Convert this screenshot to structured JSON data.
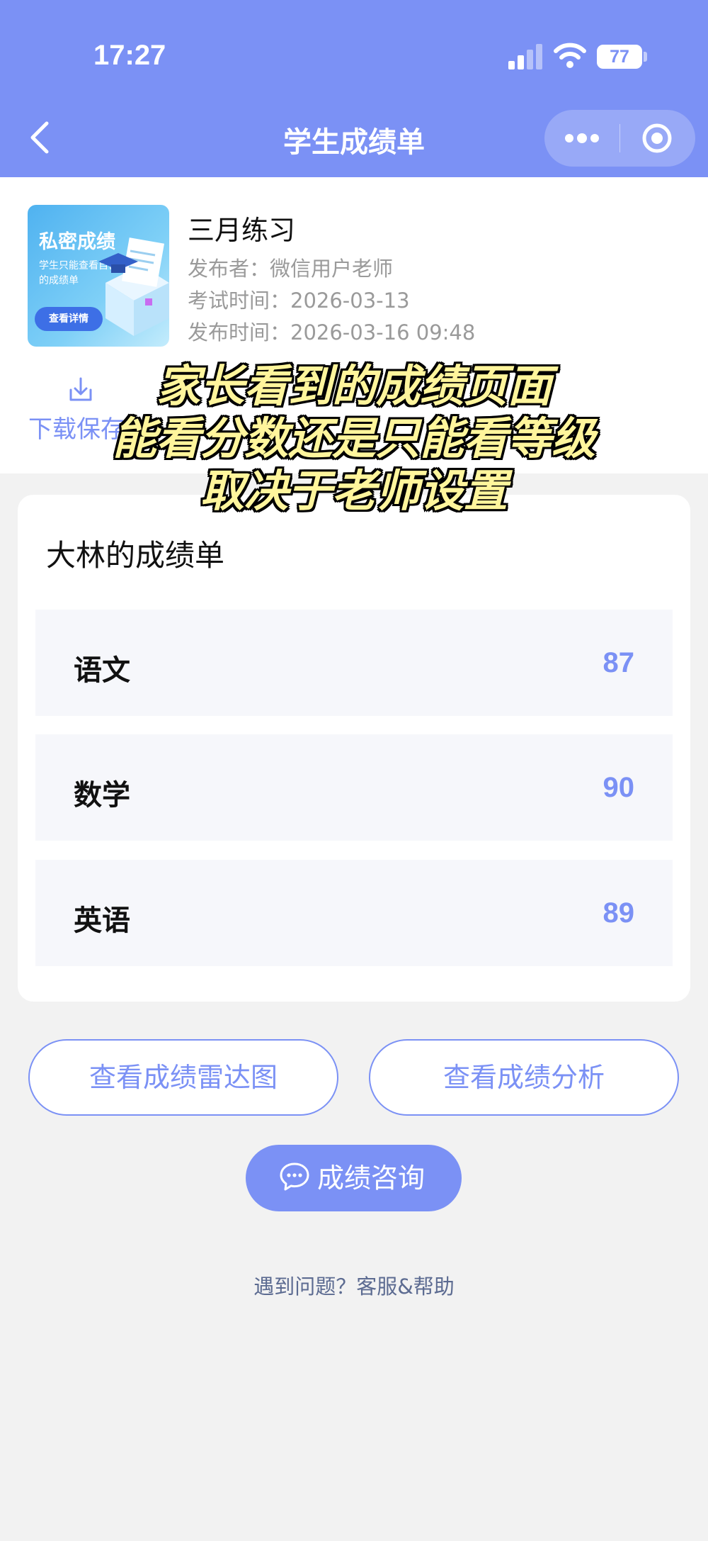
{
  "status_bar": {
    "time": "17:27",
    "battery": "77"
  },
  "nav": {
    "title": "学生成绩单"
  },
  "exam": {
    "thumb_title": "私密成绩",
    "thumb_subtitle": "学生只能查看自己的成绩单",
    "thumb_button": "查看详情",
    "name": "三月练习",
    "publisher": "发布者：微信用户老师",
    "exam_time": "考试时间：2026-03-13",
    "publish_time": "发布时间：2026-03-16 09:48"
  },
  "download": {
    "label": "下载保存"
  },
  "caption": {
    "line1": "家长看到的成绩页面",
    "line2": "能看分数还是只能看等级",
    "line3": "取决于老师设置"
  },
  "scorecard": {
    "title": "大林的成绩单",
    "rows": [
      {
        "subject": "语文",
        "score": "87"
      },
      {
        "subject": "数学",
        "score": "90"
      },
      {
        "subject": "英语",
        "score": "89"
      }
    ]
  },
  "actions": {
    "radar": "查看成绩雷达图",
    "analysis": "查看成绩分析",
    "consult": "成绩咨询"
  },
  "footer": {
    "help": "遇到问题？客服&帮助"
  },
  "colors": {
    "accent": "#7b91f5",
    "caption": "#fff59c",
    "row_bg": "#f6f7fb"
  }
}
